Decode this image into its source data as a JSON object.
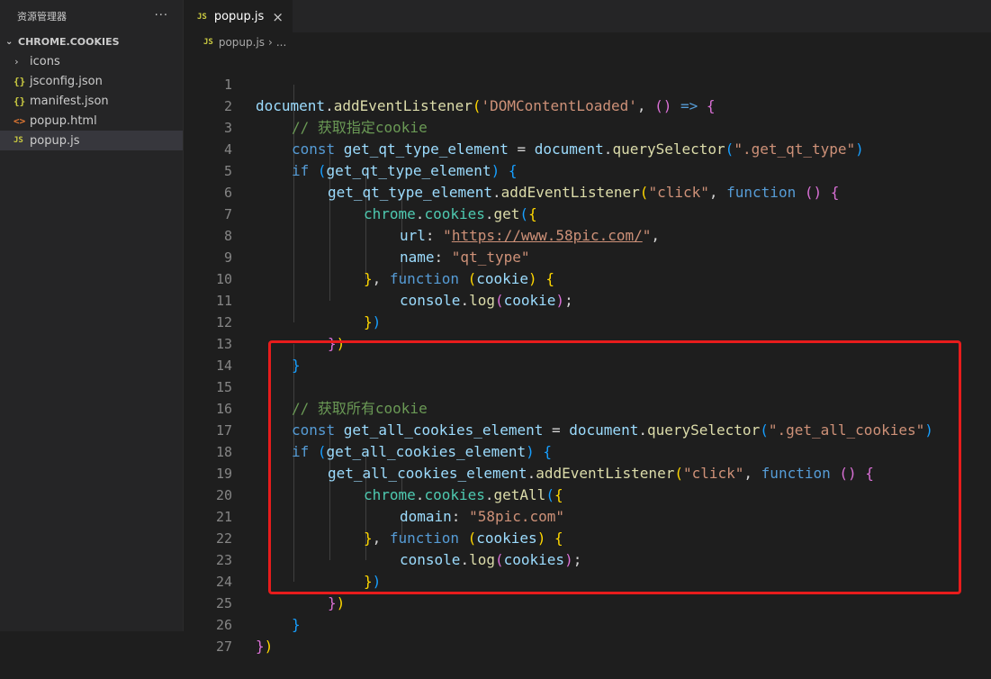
{
  "sidebar": {
    "title": "资源管理器",
    "more": "···",
    "section": "CHROME.COOKIES",
    "items": [
      {
        "label": "icons",
        "icon": "›"
      },
      {
        "label": "jsconfig.json",
        "icon": "{}"
      },
      {
        "label": "manifest.json",
        "icon": "{}"
      },
      {
        "label": "popup.html",
        "icon": "<>"
      },
      {
        "label": "popup.js",
        "icon": "JS"
      }
    ]
  },
  "tab": {
    "badge": "JS",
    "label": "popup.js",
    "close": "×"
  },
  "breadcrumb": {
    "badge": "JS",
    "file": "popup.js",
    "sep": "›",
    "rest": "..."
  },
  "line_numbers": [
    "1",
    "2",
    "3",
    "4",
    "5",
    "6",
    "7",
    "8",
    "9",
    "10",
    "11",
    "12",
    "13",
    "14",
    "15",
    "16",
    "17",
    "18",
    "19",
    "20",
    "21",
    "22",
    "23",
    "24",
    "25",
    "26",
    "27"
  ],
  "code": {
    "l1": [
      "document",
      ".",
      "addEventListener",
      "(",
      "'DOMContentLoaded'",
      ", ",
      "()",
      " => ",
      "{"
    ],
    "l2": [
      "// 获取指定cookie"
    ],
    "l3": [
      "const ",
      "get_qt_type_element",
      " = ",
      "document",
      ".",
      "querySelector",
      "(",
      "\".get_qt_type\"",
      ")"
    ],
    "l4": [
      "if ",
      "(",
      "get_qt_type_element",
      ") ",
      "{"
    ],
    "l5": [
      "get_qt_type_element",
      ".",
      "addEventListener",
      "(",
      "\"click\"",
      ", ",
      "function ",
      "()",
      " ",
      "{"
    ],
    "l6": [
      "chrome",
      ".",
      "cookies",
      ".",
      "get",
      "(",
      "{"
    ],
    "l7": [
      "url",
      ": ",
      "\"",
      "https://www.58pic.com/",
      "\"",
      ","
    ],
    "l8": [
      "name",
      ": ",
      "\"qt_type\""
    ],
    "l9": [
      "}",
      ", ",
      "function ",
      "(",
      "cookie",
      ") ",
      "{"
    ],
    "l10": [
      "console",
      ".",
      "log",
      "(",
      "cookie",
      ")",
      ";"
    ],
    "l11": [
      "}",
      ")"
    ],
    "l12": [
      "}",
      ")"
    ],
    "l13": [
      "}"
    ],
    "l15": [
      "// 获取所有cookie"
    ],
    "l16": [
      "const ",
      "get_all_cookies_element",
      " = ",
      "document",
      ".",
      "querySelector",
      "(",
      "\".get_all_cookies\"",
      ")"
    ],
    "l17": [
      "if ",
      "(",
      "get_all_cookies_element",
      ") ",
      "{"
    ],
    "l18": [
      "get_all_cookies_element",
      ".",
      "addEventListener",
      "(",
      "\"click\"",
      ", ",
      "function ",
      "()",
      " ",
      "{"
    ],
    "l19": [
      "chrome",
      ".",
      "cookies",
      ".",
      "getAll",
      "(",
      "{"
    ],
    "l20": [
      "domain",
      ": ",
      "\"58pic.com\""
    ],
    "l21": [
      "}",
      ", ",
      "function ",
      "(",
      "cookies",
      ") ",
      "{"
    ],
    "l22": [
      "console",
      ".",
      "log",
      "(",
      "cookies",
      ")",
      ";"
    ],
    "l23": [
      "}",
      ")"
    ],
    "l24": [
      "}",
      ")"
    ],
    "l25": [
      "}"
    ],
    "l26": [
      "}",
      ")"
    ]
  },
  "colors": {
    "highlight_border": "#e81c1c",
    "keyword": "#569cd6",
    "string": "#ce9178",
    "comment": "#6a9955"
  }
}
